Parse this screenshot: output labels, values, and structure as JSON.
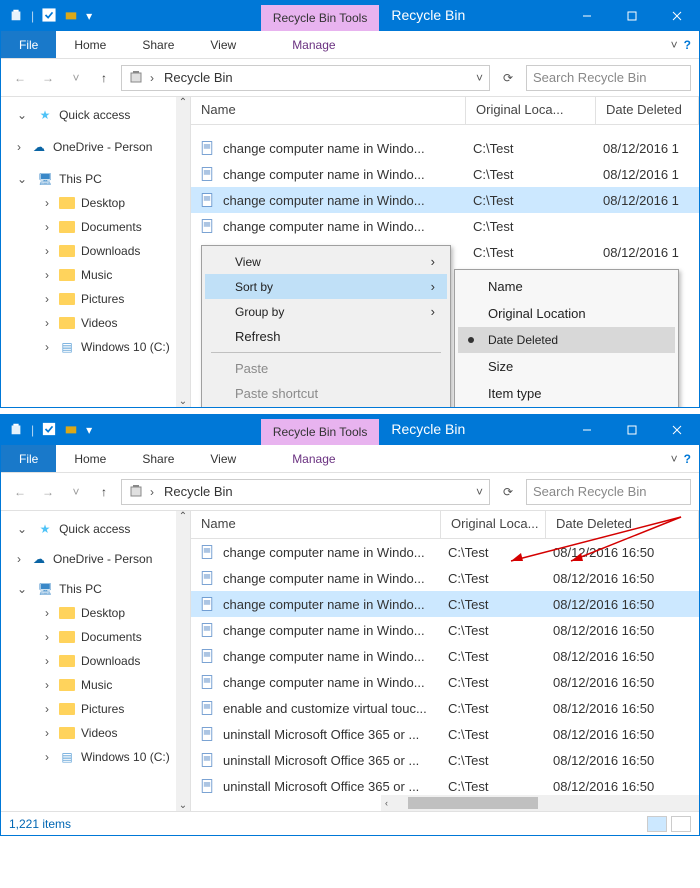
{
  "win1": {
    "tool_tab": "Recycle Bin Tools",
    "title": "Recycle Bin",
    "file": "File",
    "tabs": [
      "Home",
      "Share",
      "View"
    ],
    "manage": "Manage",
    "breadcrumb": "Recycle Bin",
    "search_placeholder": "Search Recycle Bin",
    "sidebar": {
      "quick": "Quick access",
      "onedrive": "OneDrive - Person",
      "thispc": "This PC",
      "folders": [
        "Desktop",
        "Documents",
        "Downloads",
        "Music",
        "Pictures",
        "Videos"
      ],
      "drive": "Windows 10 (C:)"
    },
    "cols": [
      "Name",
      "Original Loca...",
      "Date Deleted"
    ],
    "rows": [
      {
        "name": "change computer name in Windo...",
        "loc": "C:\\Test",
        "date": "08/12/2016 1"
      },
      {
        "name": "change computer name in Windo...",
        "loc": "C:\\Test",
        "date": "08/12/2016 1"
      },
      {
        "name": "change computer name in Windo...",
        "loc": "C:\\Test",
        "date": "08/12/2016 1"
      },
      {
        "name": "change computer name in Windo...",
        "loc": "C:\\Test",
        "date": ""
      },
      {
        "name": "",
        "loc": "C:\\Test",
        "date": "08/12/2016 1"
      }
    ],
    "ctx": {
      "view": "View",
      "sortby": "Sort by",
      "groupby": "Group by",
      "refresh": "Refresh",
      "paste": "Paste",
      "paste_shortcut": "Paste shortcut"
    },
    "ctx2": {
      "name": "Name",
      "orig": "Original Location",
      "deleted": "Date Deleted",
      "size": "Size",
      "itemtype": "Item type"
    }
  },
  "win2": {
    "tool_tab": "Recycle Bin Tools",
    "title": "Recycle Bin",
    "file": "File",
    "tabs": [
      "Home",
      "Share",
      "View"
    ],
    "manage": "Manage",
    "breadcrumb": "Recycle Bin",
    "search_placeholder": "Search Recycle Bin",
    "sidebar": {
      "quick": "Quick access",
      "onedrive": "OneDrive - Person",
      "thispc": "This PC",
      "folders": [
        "Desktop",
        "Documents",
        "Downloads",
        "Music",
        "Pictures",
        "Videos"
      ],
      "drive": "Windows 10 (C:)"
    },
    "cols": [
      "Name",
      "Original Loca...",
      "Date Deleted"
    ],
    "rows": [
      {
        "name": "change computer name in Windo...",
        "loc": "C:\\Test",
        "date": "08/12/2016 16:50"
      },
      {
        "name": "change computer name in Windo...",
        "loc": "C:\\Test",
        "date": "08/12/2016 16:50"
      },
      {
        "name": "change computer name in Windo...",
        "loc": "C:\\Test",
        "date": "08/12/2016 16:50"
      },
      {
        "name": "change computer name in Windo...",
        "loc": "C:\\Test",
        "date": "08/12/2016 16:50"
      },
      {
        "name": "change computer name in Windo...",
        "loc": "C:\\Test",
        "date": "08/12/2016 16:50"
      },
      {
        "name": "change computer name in Windo...",
        "loc": "C:\\Test",
        "date": "08/12/2016 16:50"
      },
      {
        "name": "enable and customize virtual touc...",
        "loc": "C:\\Test",
        "date": "08/12/2016 16:50"
      },
      {
        "name": "uninstall Microsoft Office 365 or ...",
        "loc": "C:\\Test",
        "date": "08/12/2016 16:50"
      },
      {
        "name": "uninstall Microsoft Office 365 or ...",
        "loc": "C:\\Test",
        "date": "08/12/2016 16:50"
      },
      {
        "name": "uninstall Microsoft Office 365 or ...",
        "loc": "C:\\Test",
        "date": "08/12/2016 16:50"
      }
    ],
    "status": "1,221 items"
  }
}
